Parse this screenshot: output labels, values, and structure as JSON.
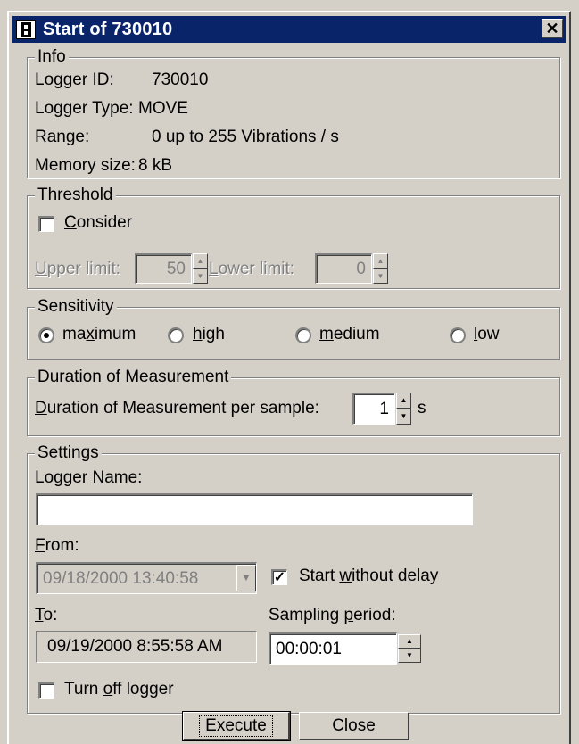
{
  "window": {
    "title": "Start of 730010",
    "close_label": "✕"
  },
  "info": {
    "legend": "Info",
    "rows": [
      {
        "label": "Logger ID:",
        "value": "730010"
      },
      {
        "label": "Logger Type:",
        "value": "MOVE"
      },
      {
        "label": "Range:",
        "value": "0 up to 255 Vibrations / s"
      },
      {
        "label": "Memory size:",
        "value": "8 kB"
      }
    ]
  },
  "threshold": {
    "legend": "Threshold",
    "consider_pre": "",
    "consider_ul": "C",
    "consider_post": "onsider",
    "consider_checked": false,
    "upper_pre": "",
    "upper_ul": "U",
    "upper_post": "pper limit:",
    "upper_value": "50",
    "lower_pre": "",
    "lower_ul": "L",
    "lower_post": "ower limit:",
    "lower_value": "0"
  },
  "sensitivity": {
    "legend": "Sensitivity",
    "options": [
      {
        "pre": "ma",
        "ul": "x",
        "post": "imum",
        "selected": true
      },
      {
        "pre": "",
        "ul": "h",
        "post": "igh",
        "selected": false
      },
      {
        "pre": "",
        "ul": "m",
        "post": "edium",
        "selected": false
      },
      {
        "pre": "",
        "ul": "l",
        "post": "ow",
        "selected": false
      }
    ]
  },
  "duration": {
    "legend": "Duration of Measurement",
    "label_pre": "",
    "label_ul": "D",
    "label_post": "uration of Measurement per sample:",
    "value": "1",
    "unit": "s"
  },
  "settings": {
    "legend": "Settings",
    "name_pre": "Logger ",
    "name_ul": "N",
    "name_post": "ame:",
    "name_value": "",
    "from_pre": "",
    "from_ul": "F",
    "from_post": "rom:",
    "from_value": "09/18/2000 13:40:58",
    "start_pre": "Start ",
    "start_ul": "w",
    "start_post": "ithout delay",
    "start_checked": true,
    "to_pre": "",
    "to_ul": "T",
    "to_post": "o:",
    "to_value": "09/19/2000 8:55:58 AM",
    "sampling_pre": "Sampling ",
    "sampling_ul": "p",
    "sampling_post": "eriod:",
    "sampling_value": "00:00:01",
    "turnoff_pre": "Turn ",
    "turnoff_ul": "o",
    "turnoff_post": "ff logger",
    "turnoff_checked": false
  },
  "buttons": {
    "execute_pre": "",
    "execute_ul": "E",
    "execute_post": "xecute",
    "close_pre": "Clo",
    "close_ul": "s",
    "close_post": "e"
  },
  "colors": {
    "face": "#d4d0c8",
    "titlebar": "#0a246a",
    "disabled_text": "#808080"
  }
}
